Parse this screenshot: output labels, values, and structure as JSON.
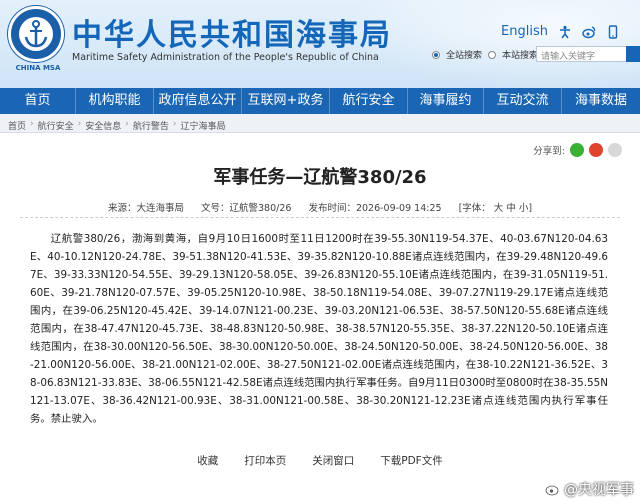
{
  "header": {
    "title": "中华人民共和国海事局",
    "subtitle": "Maritime Safety Administration of the People's Republic of China",
    "logo_text": "CHINA MSA",
    "links": [
      "English"
    ],
    "search": {
      "options": [
        "全站搜索",
        "本站搜索"
      ],
      "placeholder": "请输入关键字"
    }
  },
  "nav": {
    "items": [
      "首页",
      "机构职能",
      "政府信息公开",
      "互联网+政务",
      "航行安全",
      "海事履约",
      "互动交流",
      "海事数据"
    ]
  },
  "breadcrumb": [
    "首页",
    "航行安全",
    "安全信息",
    "航行警告",
    "辽宁海事局"
  ],
  "article": {
    "share_label": "分享到:",
    "title": "军事任务—辽航警380/26",
    "source": "来源：大连海事局",
    "doc_no": "文号：辽航警380/26",
    "date": "发布时间：2026-09-09 14:25",
    "font_label": "[字体： 大  中  小]",
    "body": "辽航警380/26，渤海到黄海，自9月10日1600时至11日1200时在39-55.30N119-54.37E、40-03.67N120-04.63E、40-10.12N120-24.78E、39-51.38N120-41.53E、39-35.82N120-10.88E诸点连线范围内，在39-29.48N120-49.67E、39-33.33N120-54.55E、39-29.13N120-58.05E、39-26.83N120-55.10E诸点连线范围内，在39-31.05N119-51.60E、39-21.78N120-07.57E、39-05.25N120-10.98E、38-50.18N119-54.08E、39-07.27N119-29.17E诸点连线范围内，在39-06.25N120-45.42E、39-14.07N121-00.23E、39-03.20N121-06.53E、38-57.50N120-55.68E诸点连线范围内，在38-47.47N120-45.73E、38-48.83N120-50.98E、38-38.57N120-55.35E、38-37.22N120-50.10E诸点连线范围内，在38-30.00N120-56.50E、38-30.00N120-50.00E、38-24.50N120-50.00E、38-24.50N120-56.00E、38-21.00N120-56.00E、38-21.00N121-02.00E、38-27.50N121-02.00E诸点连线范围内，在38-10.22N121-36.52E、38-06.83N121-33.83E、38-06.55N121-42.58E诸点连线范围内执行军事任务。自9月11日0300时至0800时在38-35.55N121-13.07E、38-36.42N121-00.93E、38-31.00N121-00.58E、38-30.20N121-12.23E诸点连线范围内执行军事任务。禁止驶入。",
    "actions": [
      "收藏",
      "打印本页",
      "关闭窗口",
      "下载PDF文件"
    ]
  },
  "watermark": "@央视军事",
  "colors": {
    "nav": "#1a66b4",
    "title": "#1466b8"
  }
}
